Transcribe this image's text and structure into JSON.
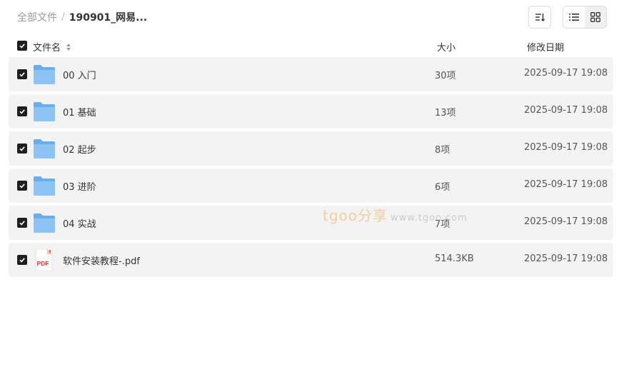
{
  "breadcrumb": {
    "root": "全部文件",
    "separator": "/",
    "current": "190901_网易..."
  },
  "toolbar": {
    "sort_icon": "sort-icon",
    "list_view_icon": "list-view-icon",
    "grid_view_icon": "grid-view-icon"
  },
  "table": {
    "headers": {
      "name": "文件名",
      "size": "大小",
      "date": "修改日期"
    },
    "rows": [
      {
        "type": "folder",
        "name": "00 入门",
        "size": "30项",
        "date": "2025-09-17 19:08"
      },
      {
        "type": "folder",
        "name": "01 基础",
        "size": "13项",
        "date": "2025-09-17 19:08"
      },
      {
        "type": "folder",
        "name": "02 起步",
        "size": "8项",
        "date": "2025-09-17 19:08"
      },
      {
        "type": "folder",
        "name": "03 进阶",
        "size": "6项",
        "date": "2025-09-17 19:08"
      },
      {
        "type": "folder",
        "name": "04 实战",
        "size": "7项",
        "date": "2025-09-17 19:08"
      },
      {
        "type": "pdf",
        "name": "软件安装教程-.pdf",
        "size": "514.3KB",
        "date": "2025-09-17 19:08",
        "badge": "PDF"
      }
    ]
  },
  "watermark": {
    "brand": "tgoo分享",
    "url": "www.tgoo.com"
  },
  "colors": {
    "row_bg": "#f3f3f3",
    "checkbox": "#1f1f1f",
    "folder": "#7cb7f0",
    "pdf_red": "#e23b3b"
  }
}
